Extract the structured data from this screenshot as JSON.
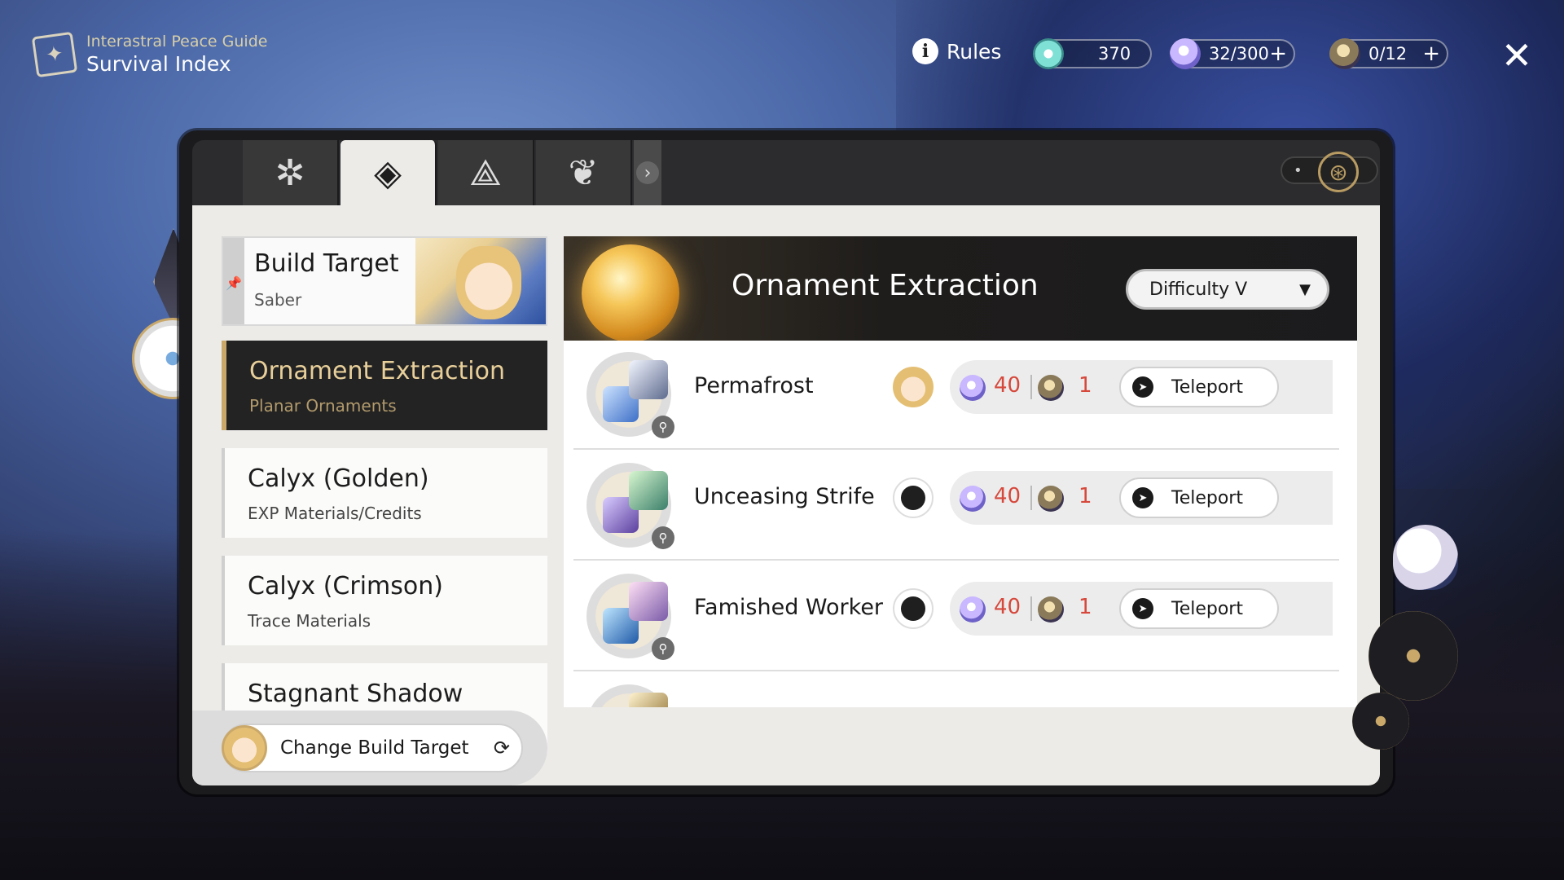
{
  "guide": {
    "subtitle": "Interastral Peace Guide",
    "title": "Survival Index",
    "icon": "guide-book-icon"
  },
  "topbar": {
    "rules_label": "Rules",
    "stellar_jade": {
      "value": "370",
      "icon": "stellar-jade-icon"
    },
    "trailblaze_power": {
      "value": "32/300",
      "icon": "trailblaze-power-icon"
    },
    "reserved_fuel": {
      "value": "0/12",
      "icon": "reserved-trailblaze-power-icon"
    },
    "plus_label": "+",
    "close_icon": "close-icon"
  },
  "tabs": [
    {
      "icon": "compass-star-icon",
      "active": false
    },
    {
      "icon": "survival-index-icon",
      "active": true
    },
    {
      "icon": "treasure-icon",
      "active": false
    },
    {
      "icon": "lotus-icon",
      "active": false
    }
  ],
  "build_target": {
    "title": "Build Target",
    "character": "Saber"
  },
  "menu": [
    {
      "title": "Ornament Extraction",
      "sub": "Planar Ornaments",
      "active": true
    },
    {
      "title": "Calyx (Golden)",
      "sub": "EXP Materials/Credits",
      "active": false
    },
    {
      "title": "Calyx (Crimson)",
      "sub": "Trace Materials",
      "active": false
    },
    {
      "title": "Stagnant Shadow",
      "sub": "",
      "active": false
    }
  ],
  "change_build_label": "Change Build Target",
  "content": {
    "title": "Ornament Extraction",
    "difficulty": "Difficulty V",
    "rows": [
      {
        "name": "Permafrost",
        "power_cost": "40",
        "fuel_cost": "1",
        "action": "Teleport",
        "avatar": "saber-avatar"
      },
      {
        "name": "Unceasing Strife",
        "power_cost": "40",
        "fuel_cost": "1",
        "action": "Teleport",
        "avatar": "dark-emblem-icon"
      },
      {
        "name": "Famished Worker",
        "power_cost": "40",
        "fuel_cost": "1",
        "action": "Teleport",
        "avatar": "dark-emblem-icon"
      }
    ]
  },
  "colors": {
    "accent_gold": "#c9a86a",
    "cost_red": "#d6483c",
    "panel_dark": "#1b1b1d"
  }
}
